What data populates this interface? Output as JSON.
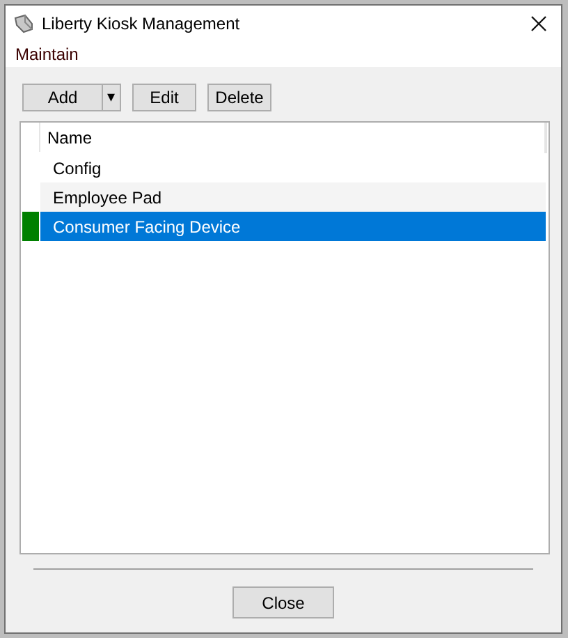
{
  "window": {
    "title": "Liberty Kiosk Management"
  },
  "menu": [
    "Maintain"
  ],
  "toolbar": {
    "add": "Add",
    "add_dropdown": "▾",
    "edit": "Edit",
    "delete": "Delete"
  },
  "table": {
    "columns": [
      "Name"
    ],
    "rows": [
      {
        "name": "Config",
        "selected": false,
        "marked": false
      },
      {
        "name": "Employee Pad",
        "selected": false,
        "marked": false
      },
      {
        "name": "Consumer Facing Device",
        "selected": true,
        "marked": true
      }
    ]
  },
  "buttons": [
    "Close"
  ]
}
